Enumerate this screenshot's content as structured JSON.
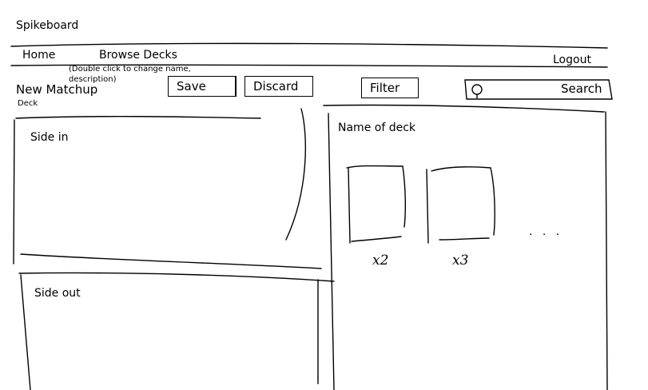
{
  "app": {
    "title": "Spikeboard"
  },
  "nav": {
    "home": "Home",
    "browse_decks": "Browse Decks",
    "logout": "Logout"
  },
  "matchup": {
    "title": "New Matchup",
    "hint": "(Double click to change name, description)",
    "subtitle": "Deck"
  },
  "toolbar": {
    "save": "Save",
    "discard": "Discard",
    "filter": "Filter"
  },
  "search": {
    "label": "Search",
    "icon": "search-icon"
  },
  "panels": {
    "side_in": "Side in",
    "side_out": "Side out"
  },
  "deck": {
    "name": "Name of deck",
    "cards": [
      {
        "count": "x2"
      },
      {
        "count": "x3"
      }
    ],
    "more": ". . ."
  }
}
